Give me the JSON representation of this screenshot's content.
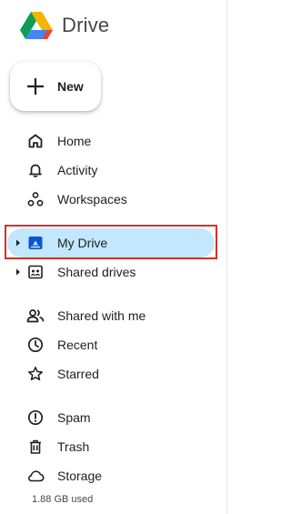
{
  "app": {
    "title": "Drive"
  },
  "new_button": {
    "label": "New"
  },
  "nav": [
    {
      "id": "home",
      "label": "Home",
      "icon": "home-icon"
    },
    {
      "id": "activity",
      "label": "Activity",
      "icon": "bell-icon"
    },
    {
      "id": "workspaces",
      "label": "Workspaces",
      "icon": "workspaces-icon"
    },
    {
      "id": "my-drive",
      "label": "My Drive",
      "icon": "my-drive-icon",
      "selected": true,
      "expandable": true
    },
    {
      "id": "shared-drives",
      "label": "Shared drives",
      "icon": "shared-drives-icon",
      "expandable": true
    },
    {
      "id": "shared-with-me",
      "label": "Shared with me",
      "icon": "people-icon"
    },
    {
      "id": "recent",
      "label": "Recent",
      "icon": "clock-icon"
    },
    {
      "id": "starred",
      "label": "Starred",
      "icon": "star-icon"
    },
    {
      "id": "spam",
      "label": "Spam",
      "icon": "spam-icon"
    },
    {
      "id": "trash",
      "label": "Trash",
      "icon": "trash-icon"
    },
    {
      "id": "storage",
      "label": "Storage",
      "icon": "cloud-icon"
    }
  ],
  "storage": {
    "used_text": "1.88 GB used"
  },
  "colors": {
    "selected_bg": "#c2e7ff",
    "highlight_outline": "#d93025",
    "logo_green": "#0f9d58",
    "logo_blue": "#4285f4",
    "logo_yellow": "#f4b400",
    "logo_red": "#ea4335"
  }
}
